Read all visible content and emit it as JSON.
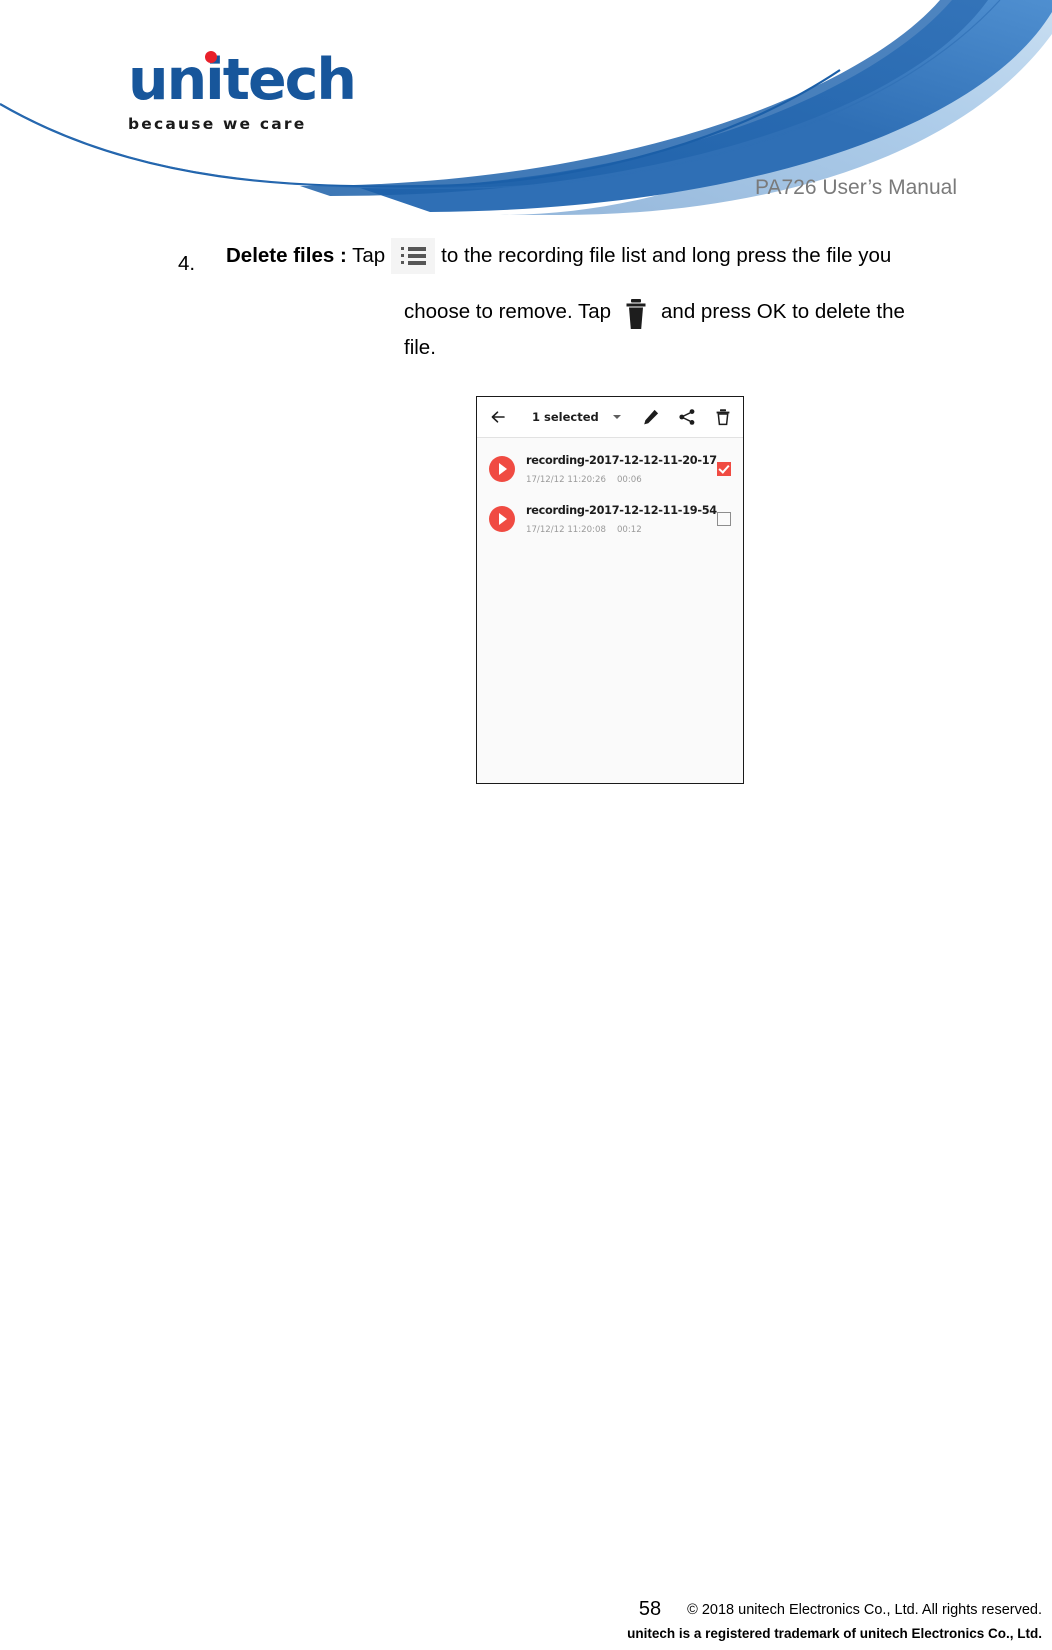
{
  "header": {
    "logo_word": "unitech",
    "logo_tagline": "because we care",
    "manual_title": "PA726 User’s Manual",
    "logo_blue": "#17569b",
    "logo_dot_red": "#e8202a",
    "swoosh_blue": "#2f6fb5"
  },
  "content": {
    "step_number": "4.",
    "step_label": "Delete files :",
    "text_a": "Tap",
    "icon_list": "list-icon",
    "text_b": "to the recording file list and long press the file you",
    "text_c": "choose to remove. Tap",
    "icon_trash": "trash-icon",
    "text_d": "and press OK to delete the",
    "text_e": "file."
  },
  "screenshot": {
    "toolbar": {
      "back_icon": "arrow-left-icon",
      "title": "1 selected",
      "caret_icon": "chevron-down-icon",
      "edit_icon": "pencil-icon",
      "share_icon": "share-icon",
      "delete_icon": "trash-icon"
    },
    "accent_red": "#f04b42",
    "rows": [
      {
        "name": "recording-2017-12-12-11-20-17",
        "date": "17/12/12 11:20:26",
        "duration": "00:06",
        "checked": true
      },
      {
        "name": "recording-2017-12-12-11-19-54",
        "date": "17/12/12 11:20:08",
        "duration": "00:12",
        "checked": false
      }
    ]
  },
  "footer": {
    "page_number": "58",
    "copyright": "© 2018 unitech Electronics Co., Ltd. All rights reserved.",
    "trademark": "unitech is a registered trademark of unitech Electronics Co., Ltd."
  }
}
